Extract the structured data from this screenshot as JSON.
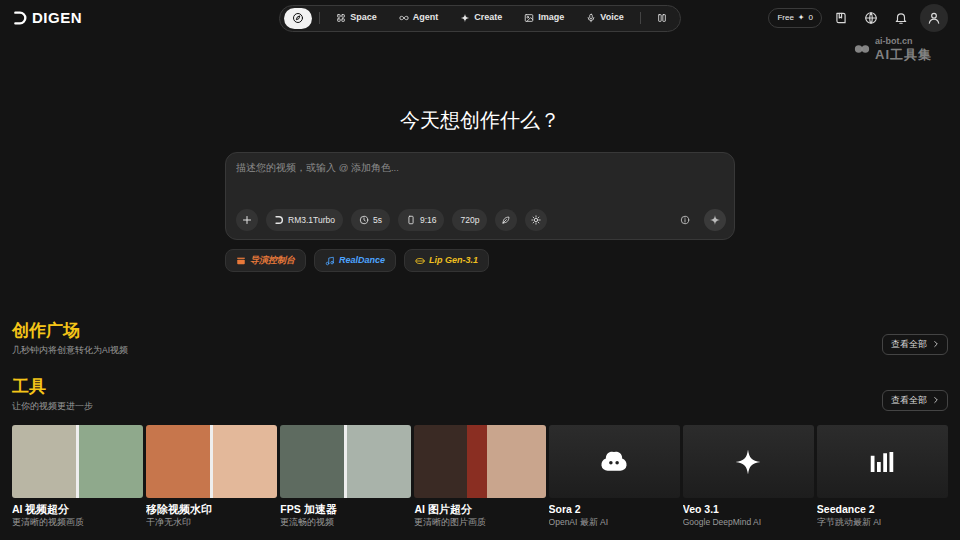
{
  "brand": {
    "name": "DIGEN"
  },
  "nav": {
    "items": [
      {
        "kind": "home",
        "selected": true
      },
      {
        "kind": "link",
        "label": "Space",
        "selected": false
      },
      {
        "kind": "link",
        "label": "Agent",
        "selected": false
      },
      {
        "kind": "link",
        "label": "Create",
        "selected": false
      },
      {
        "kind": "link",
        "label": "Image",
        "selected": false
      },
      {
        "kind": "link",
        "label": "Voice",
        "selected": false
      }
    ]
  },
  "credits": {
    "plan": "Free",
    "icon": "✦",
    "count": "0"
  },
  "watermark": {
    "site": "ai-bot.cn",
    "name": "AI工具集"
  },
  "hero": {
    "title": "今天想创作什么？"
  },
  "prompt": {
    "placeholder": "描述您的视频，或输入 @ 添加角色...",
    "options": [
      {
        "kind": "model",
        "label": "RM3.1Turbo"
      },
      {
        "kind": "duration",
        "label": "5s"
      },
      {
        "kind": "ratio",
        "label": "9:16"
      },
      {
        "kind": "resolution",
        "label": "720p"
      }
    ]
  },
  "shortcuts": [
    {
      "label": "导演控制台",
      "color": "#e8793a"
    },
    {
      "label": "RealDance",
      "color": "#4da3ff"
    },
    {
      "label": "Lip Gen-3.1",
      "color": "#f0c020"
    }
  ],
  "sections": [
    {
      "title": "创作广场",
      "subtitle": "几秒钟内将创意转化为AI视频",
      "more": "查看全部"
    },
    {
      "title": "工具",
      "subtitle": "让你的视频更进一步",
      "more": "查看全部"
    }
  ],
  "tools": [
    {
      "kind": "photo",
      "title": "AI 视频超分",
      "subtitle": "更清晰的视频画质"
    },
    {
      "kind": "photo",
      "title": "移除视频水印",
      "subtitle": "干净无水印"
    },
    {
      "kind": "photo",
      "title": "FPS 加速器",
      "subtitle": "更流畅的视频"
    },
    {
      "kind": "photo",
      "title": "AI 图片超分",
      "subtitle": "更清晰的图片画质"
    },
    {
      "kind": "logo",
      "title": "Sora 2",
      "subtitle": "OpenAI 最新 AI"
    },
    {
      "kind": "logo",
      "title": "Veo 3.1",
      "subtitle": "Google DeepMind AI"
    },
    {
      "kind": "logo",
      "title": "Seedance 2",
      "subtitle": "字节跳动最新 AI"
    }
  ]
}
